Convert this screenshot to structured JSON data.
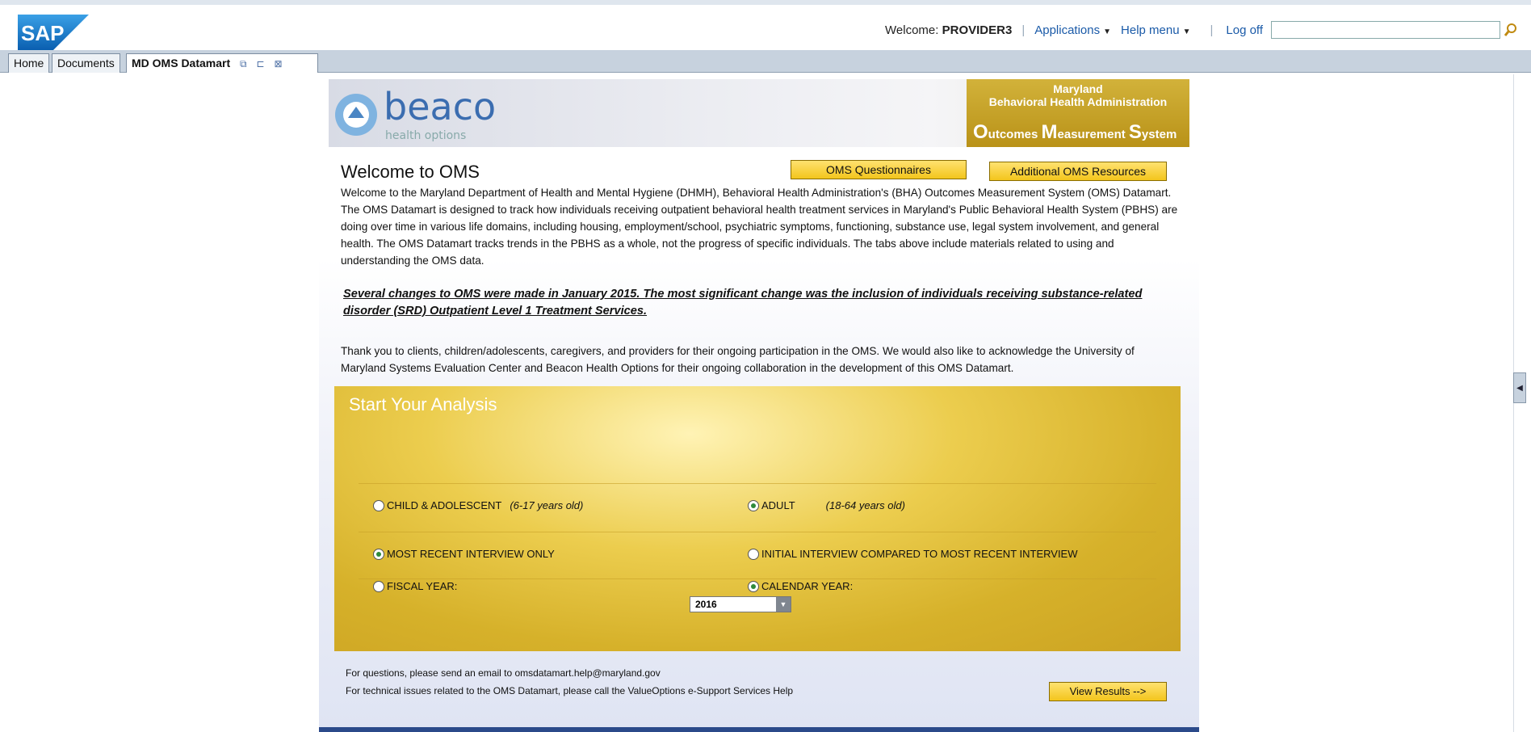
{
  "header": {
    "logo_text": "SAP",
    "welcome_prefix": "Welcome:",
    "user": "PROVIDER3",
    "menus": [
      "Applications",
      "Help menu"
    ],
    "logoff": "Log off",
    "search_placeholder": ""
  },
  "tabs": [
    {
      "label": "Home"
    },
    {
      "label": "Documents"
    },
    {
      "label": "MD OMS Datamart",
      "active": true
    }
  ],
  "banner": {
    "brand": "beacon",
    "brand_sub": "health options",
    "bha_line1": "Maryland",
    "bha_line2": "Behavioral Health Administration",
    "oms_o": "O",
    "oms_o_rest": "utcomes ",
    "oms_m": "M",
    "oms_m_rest": "easurement ",
    "oms_s": "S",
    "oms_s_rest": "ystem"
  },
  "content": {
    "title": "Welcome to OMS",
    "btn_questionnaires": "OMS Questionnaires",
    "btn_resources": "Additional OMS Resources",
    "intro": "Welcome to the Maryland Department of Health and Mental Hygiene (DHMH), Behavioral Health Administration's (BHA) Outcomes Measurement System (OMS) Datamart.  The OMS Datamart is designed to track how individuals receiving outpatient behavioral health treatment services in Maryland's Public Behavioral Health System (PBHS) are doing over time in various life domains, including housing, employment/school, psychiatric symptoms, functioning, substance use, legal system involvement, and general health.  The OMS Datamart tracks trends in the PBHS as a whole, not the progress of specific individuals.  The tabs above include materials related to using and understanding the OMS data.",
    "notice": "Several changes to OMS were made in January 2015.  The most significant change was the inclusion of individuals receiving substance-related disorder (SRD) Outpatient Level 1 Treatment Services.",
    "thanks": "Thank you to clients, children/adolescents, caregivers, and providers for their ongoing participation in the OMS.  We would also like to acknowledge the University of Maryland Systems Evaluation Center and Beacon Health Options for their ongoing collaboration in the development of this OMS Datamart."
  },
  "analysis": {
    "title": "Start Your Analysis",
    "child_label": "CHILD & ADOLESCENT",
    "child_note": "(6-17 years old)",
    "child_checked": false,
    "adult_label": "ADULT",
    "adult_note": "(18-64 years old)",
    "adult_checked": true,
    "recent_label": "MOST RECENT INTERVIEW ONLY",
    "recent_checked": true,
    "initial_label": "INITIAL INTERVIEW COMPARED TO MOST RECENT INTERVIEW",
    "initial_checked": false,
    "fiscal_label": "FISCAL YEAR:",
    "fiscal_checked": false,
    "calendar_label": "CALENDAR YEAR:",
    "calendar_checked": true,
    "year_value": "2016"
  },
  "footer": {
    "line1": "For questions, please send an email to omsdatamart.help@maryland.gov",
    "line2": "For technical issues related to the OMS Datamart, please call the ValueOptions e-Support Services Help",
    "view_results": "View Results -->"
  }
}
